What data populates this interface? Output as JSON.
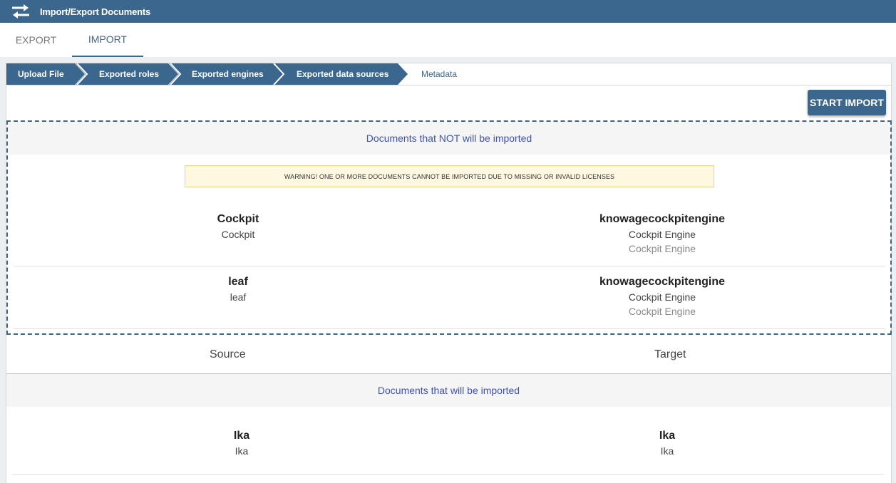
{
  "app": {
    "title": "Import/Export Documents",
    "icon": "swap-arrows-icon"
  },
  "tabs": [
    {
      "label": "EXPORT",
      "active": false
    },
    {
      "label": "IMPORT",
      "active": true
    }
  ],
  "steps": [
    {
      "label": "Upload File",
      "done": true
    },
    {
      "label": "Exported roles",
      "done": true
    },
    {
      "label": "Exported engines",
      "done": true
    },
    {
      "label": "Exported data sources",
      "done": true
    },
    {
      "label": "Metadata",
      "done": false
    }
  ],
  "actions": {
    "start_import": "START IMPORT"
  },
  "not_imported": {
    "header": "Documents that NOT will be imported",
    "warning": "WARNING! ONE OR MORE DOCUMENTS CANNOT BE IMPORTED DUE TO MISSING OR INVALID LICENSES",
    "rows": [
      {
        "source_name": "Cockpit",
        "source_desc": "Cockpit",
        "target_name": "knowagecockpitengine",
        "target_desc": "Cockpit Engine",
        "target_sub": "Cockpit Engine"
      },
      {
        "source_name": "leaf",
        "source_desc": "leaf",
        "target_name": "knowagecockpitengine",
        "target_desc": "Cockpit Engine",
        "target_sub": "Cockpit Engine"
      }
    ]
  },
  "columns": {
    "source": "Source",
    "target": "Target"
  },
  "imported": {
    "header": "Documents that will be imported",
    "rows": [
      {
        "source_name": "Ika",
        "source_desc": "Ika",
        "target_name": "Ika",
        "target_desc": "Ika"
      }
    ]
  },
  "colors": {
    "primary": "#3b678f",
    "link": "#3f51b5",
    "warning_bg": "#fff8e1"
  }
}
